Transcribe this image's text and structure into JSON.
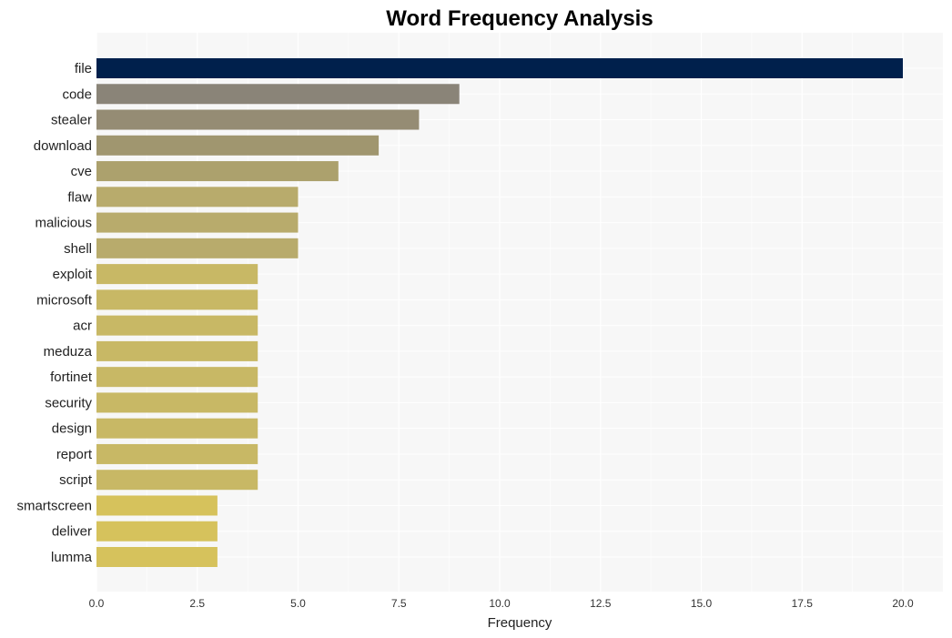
{
  "chart_data": {
    "type": "bar",
    "orientation": "horizontal",
    "title": "Word Frequency Analysis",
    "xlabel": "Frequency",
    "ylabel": "",
    "xlim": [
      0,
      21
    ],
    "xticks": [
      "0.0",
      "2.5",
      "5.0",
      "7.5",
      "10.0",
      "12.5",
      "15.0",
      "17.5",
      "20.0"
    ],
    "xtick_values": [
      0,
      2.5,
      5,
      7.5,
      10,
      12.5,
      15,
      17.5,
      20
    ],
    "grid": true,
    "categories": [
      "file",
      "code",
      "stealer",
      "download",
      "cve",
      "flaw",
      "malicious",
      "shell",
      "exploit",
      "microsoft",
      "acr",
      "meduza",
      "fortinet",
      "security",
      "design",
      "report",
      "script",
      "smartscreen",
      "deliver",
      "lumma"
    ],
    "values": [
      20,
      9,
      8,
      7,
      6,
      5,
      5,
      5,
      4,
      4,
      4,
      4,
      4,
      4,
      4,
      4,
      4,
      3,
      3,
      3
    ],
    "colors": [
      "#00204c",
      "#8a8478",
      "#958c74",
      "#a0966f",
      "#aca16d",
      "#b8ab6c",
      "#b8ab6c",
      "#b8ab6c",
      "#c8b865",
      "#c8b865",
      "#c8b865",
      "#c8b865",
      "#c8b865",
      "#c8b865",
      "#c8b865",
      "#c8b865",
      "#c8b865",
      "#d6c25c",
      "#d6c25c",
      "#d6c25c"
    ],
    "background": "#f7f7f7"
  }
}
